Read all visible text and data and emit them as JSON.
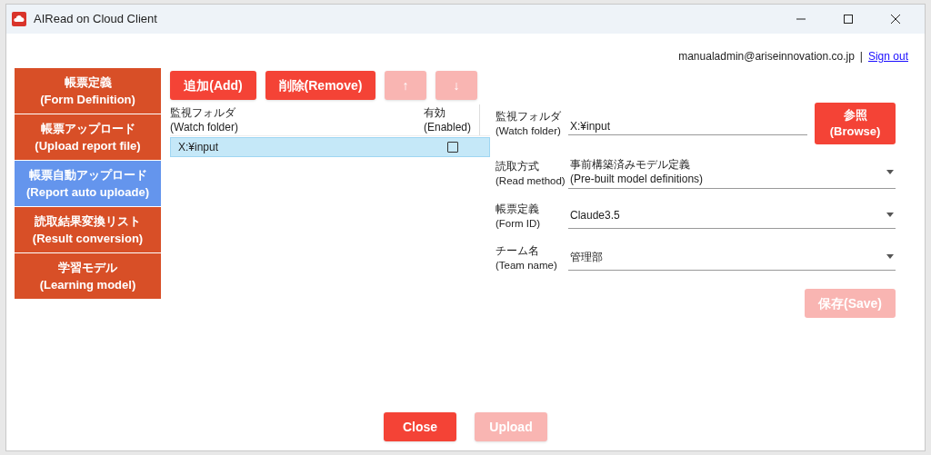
{
  "window": {
    "title": "AIRead on Cloud Client"
  },
  "account": {
    "email": "manualadmin@ariseinnovation.co.jp",
    "separator": "|",
    "sign_out": "Sign out"
  },
  "sidebar": {
    "items": [
      {
        "label": "帳票定義",
        "sublabel": "(Form Definition)",
        "selected": false
      },
      {
        "label": "帳票アップロード",
        "sublabel": "(Upload report file)",
        "selected": false
      },
      {
        "label": "帳票自動アップロード",
        "sublabel": "(Report auto uploade)",
        "selected": true
      },
      {
        "label": "読取結果変換リスト",
        "sublabel": "(Result conversion)",
        "selected": false
      },
      {
        "label": "学習モデル",
        "sublabel": "(Learning model)",
        "selected": false
      }
    ]
  },
  "toolbar": [
    {
      "label": "追加(Add)",
      "disabled": false
    },
    {
      "label": "削除(Remove)",
      "disabled": false
    },
    {
      "label": "↑",
      "disabled": true
    },
    {
      "label": "↓",
      "disabled": true
    }
  ],
  "table": {
    "columns": [
      {
        "label": "監視フォルダ",
        "sublabel": "(Watch folder)"
      },
      {
        "label": "有効",
        "sublabel": "(Enabled)"
      }
    ],
    "rows": [
      {
        "folder": "X:¥input",
        "enabled": false,
        "selected": true
      }
    ]
  },
  "form": {
    "fields": [
      {
        "kind": "text",
        "label": "監視フォルダ",
        "sublabel": "(Watch folder)",
        "value": "X:¥input"
      },
      {
        "kind": "dropdown",
        "label": "読取方式",
        "sublabel": "(Read method)",
        "value": "事前構築済みモデル定義",
        "subvalue": "(Pre-built model definitions)"
      },
      {
        "kind": "dropdown",
        "label": "帳票定義",
        "sublabel": "(Form ID)",
        "value": "Claude3.5"
      },
      {
        "kind": "dropdown",
        "label": "チーム名",
        "sublabel": "(Team name)",
        "value": "管理部"
      }
    ],
    "browse_button": {
      "label": "参照",
      "sublabel": "(Browse)",
      "disabled": false
    },
    "save_button": {
      "label": "保存(Save)",
      "disabled": true
    }
  },
  "footer": [
    {
      "label": "Close",
      "disabled": false
    },
    {
      "label": "Upload",
      "disabled": true
    }
  ]
}
